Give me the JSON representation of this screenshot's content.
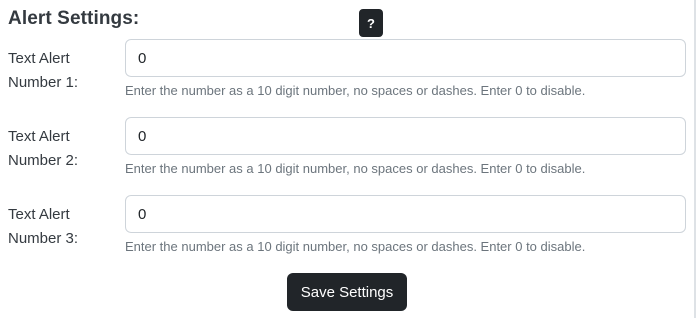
{
  "title": "Alert Settings:",
  "help_label": "?",
  "fields": [
    {
      "label_line1": "Text Alert",
      "label_line2": "Number 1:",
      "value": "0",
      "hint": "Enter the number as a 10 digit number, no spaces or dashes. Enter 0 to disable."
    },
    {
      "label_line1": "Text Alert",
      "label_line2": "Number 2:",
      "value": "0",
      "hint": "Enter the number as a 10 digit number, no spaces or dashes. Enter 0 to disable."
    },
    {
      "label_line1": "Text Alert",
      "label_line2": "Number 3:",
      "value": "0",
      "hint": "Enter the number as a 10 digit number, no spaces or dashes. Enter 0 to disable."
    }
  ],
  "save_label": "Save Settings",
  "colors": {
    "button_bg": "#212529",
    "hint_text": "#6c757d",
    "input_border": "#ced4da"
  }
}
